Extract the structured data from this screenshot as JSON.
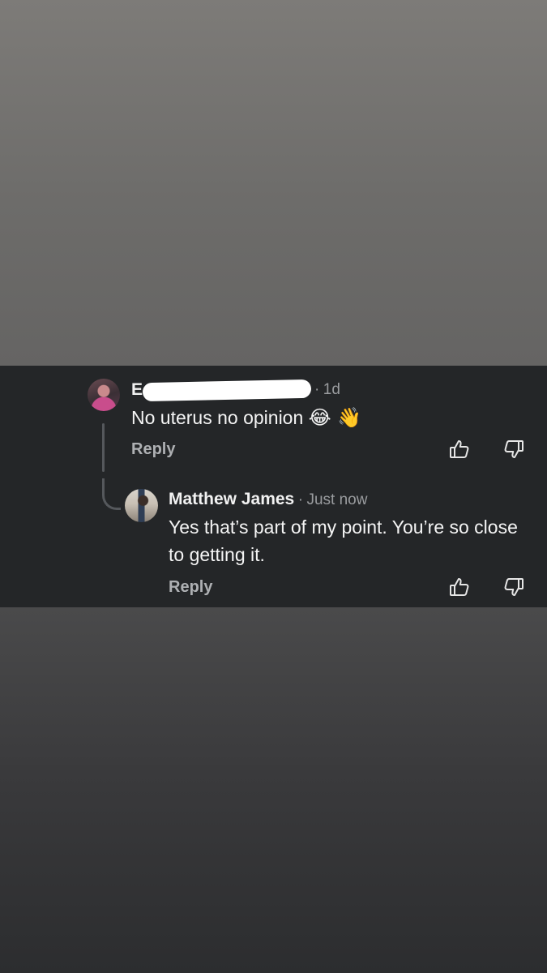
{
  "comments": [
    {
      "author": "E",
      "separator": "·",
      "time": "1d",
      "text": "No uterus no opinion",
      "emojis": "😂 👋",
      "reply_label": "Reply"
    },
    {
      "author": "Matthew James",
      "separator": "·",
      "time": "Just now",
      "text": "Yes that’s part of my point. You’re so close to getting it.",
      "reply_label": "Reply"
    }
  ],
  "icons": {
    "upvote": "thumbs-up-icon",
    "downvote": "thumbs-down-icon"
  },
  "colors": {
    "panel_bg": "#242628",
    "text": "#f4f4f4",
    "muted": "#9a9c9f"
  }
}
